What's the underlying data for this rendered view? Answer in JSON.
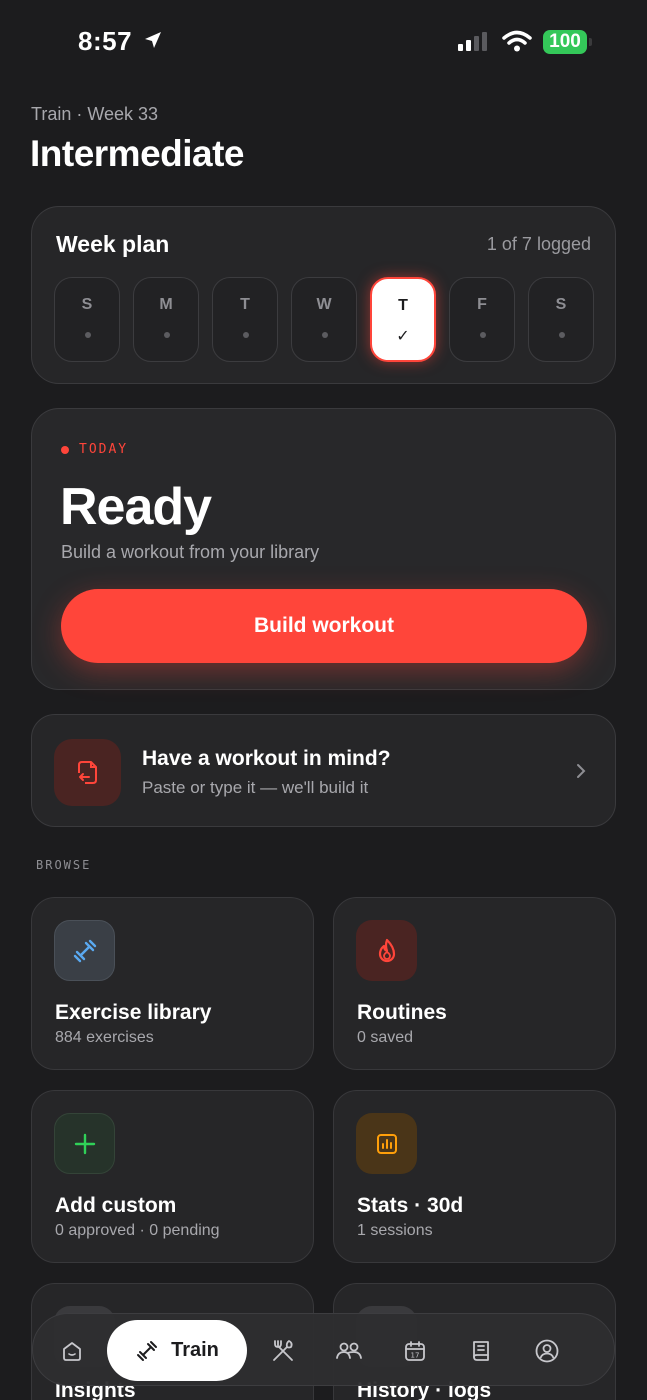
{
  "status_bar": {
    "time": "8:57",
    "battery": "100"
  },
  "header": {
    "breadcrumb": "Train · Week 33",
    "title": "Intermediate"
  },
  "week_plan": {
    "title": "Week plan",
    "logged": "1 of 7 logged",
    "days": [
      {
        "letter": "S",
        "state": "empty"
      },
      {
        "letter": "M",
        "state": "empty"
      },
      {
        "letter": "T",
        "state": "empty"
      },
      {
        "letter": "W",
        "state": "empty"
      },
      {
        "letter": "T",
        "state": "logged",
        "mark": "✓"
      },
      {
        "letter": "F",
        "state": "empty"
      },
      {
        "letter": "S",
        "state": "empty"
      }
    ]
  },
  "today": {
    "tag": "TODAY",
    "title": "Ready",
    "subtitle": "Build a workout from your library",
    "button": "Build workout"
  },
  "import_card": {
    "title": "Have a workout in mind?",
    "subtitle": "Paste or type it — we'll build it"
  },
  "browse": {
    "label": "BROWSE",
    "tiles": [
      {
        "title": "Exercise library",
        "subtitle": "884 exercises",
        "icon": "dumbbell-icon",
        "color": "#5aa9f0"
      },
      {
        "title": "Routines",
        "subtitle": "0 saved",
        "icon": "flame-icon",
        "color": "#ff453a"
      },
      {
        "title": "Add custom",
        "subtitle": "0 approved · 0 pending",
        "icon": "plus-icon",
        "color": "#30d158"
      },
      {
        "title": "Stats · 30d",
        "subtitle": "1 sessions",
        "icon": "chart-icon",
        "color": "#ff9f0a"
      },
      {
        "title": "Insights",
        "subtitle": ""
      },
      {
        "title": "History · logs",
        "subtitle": ""
      }
    ]
  },
  "bottom_nav": {
    "active_label": "Train",
    "items": [
      "home-icon",
      "train-icon",
      "nutrition-icon",
      "community-icon",
      "calendar-icon",
      "journal-icon",
      "profile-icon"
    ]
  },
  "colors": {
    "accent": "#ff453a",
    "background": "#1c1c1e",
    "card": "#262628"
  }
}
